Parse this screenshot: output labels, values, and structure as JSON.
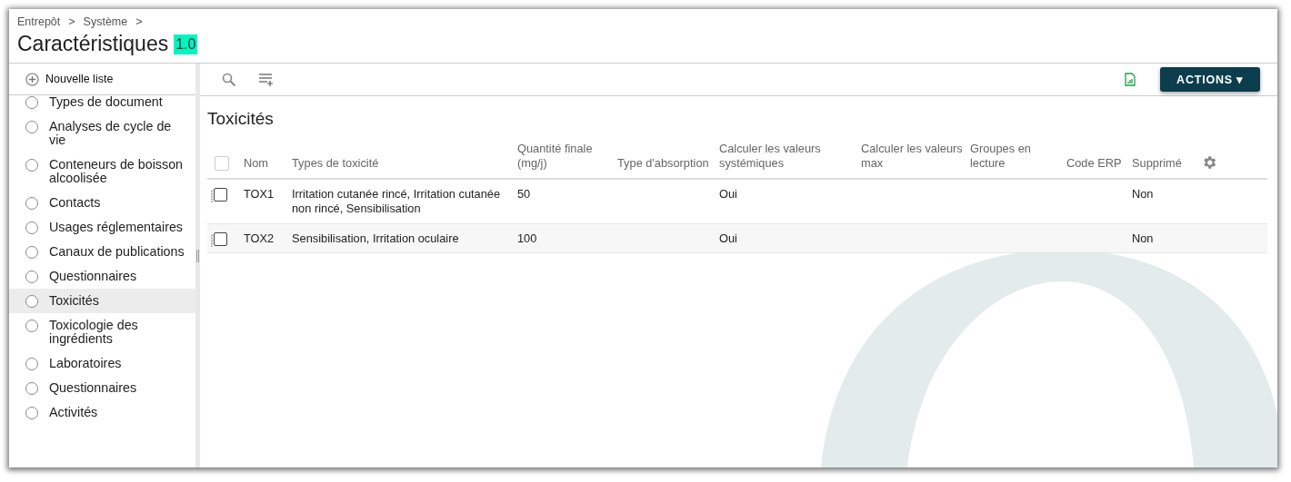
{
  "breadcrumb": [
    "Entrepôt",
    "Système"
  ],
  "breadcrumb_separator": ">",
  "title": "Caractéristiques",
  "version": "1.0",
  "sidebar": {
    "new_list": "Nouvelle liste",
    "items": [
      {
        "label": "Types de document",
        "selected": false
      },
      {
        "label": "Analyses de cycle de vie",
        "selected": false
      },
      {
        "label": "Conteneurs de boisson alcoolisée",
        "selected": false
      },
      {
        "label": "Contacts",
        "selected": false
      },
      {
        "label": "Usages réglementaires",
        "selected": false
      },
      {
        "label": "Canaux de publications",
        "selected": false
      },
      {
        "label": "Questionnaires",
        "selected": false
      },
      {
        "label": "Toxicités",
        "selected": true
      },
      {
        "label": "Toxicologie des ingrédients",
        "selected": false
      },
      {
        "label": "Laboratoires",
        "selected": false
      },
      {
        "label": "Questionnaires",
        "selected": false
      },
      {
        "label": "Activités",
        "selected": false
      }
    ]
  },
  "toolbar": {
    "actions_button": "ACTIONS ▾"
  },
  "list_title": "Toxicités",
  "table": {
    "select_all_checked": false,
    "columns": [
      "Nom",
      "Types de toxicité",
      "Quantité finale (mg/j)",
      "Type d'absorption",
      "Calculer les valeurs systémiques",
      "Calculer les valeurs max",
      "Groupes en lecture",
      "Code ERP",
      "Supprimé"
    ],
    "rows": [
      {
        "checked": false,
        "cells": [
          "TOX1",
          "Irritation cutanée rincé, Irritation cutanée non rincé, Sensibilisation",
          "50",
          "",
          "Oui",
          "",
          "",
          "",
          "Non"
        ]
      },
      {
        "checked": false,
        "cells": [
          "TOX2",
          "Sensibilisation, Irritation oculaire",
          "100",
          "",
          "Oui",
          "",
          "",
          "",
          "Non"
        ]
      }
    ]
  }
}
